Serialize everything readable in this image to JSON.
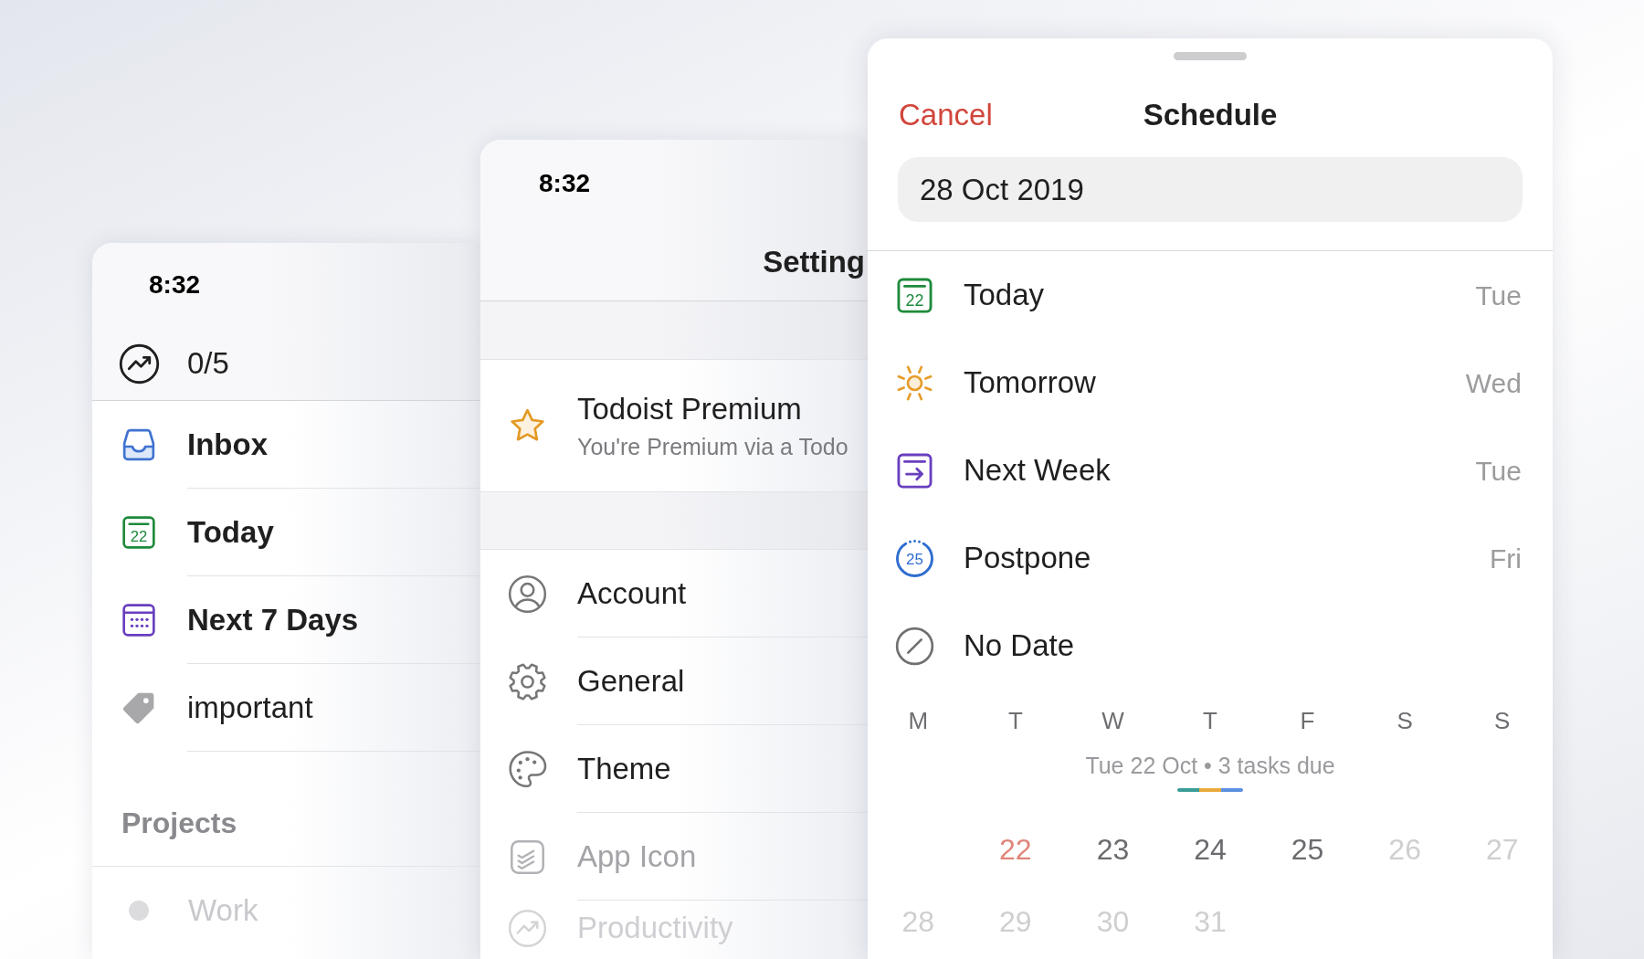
{
  "sidebar_screen": {
    "status_time": "8:32",
    "karma": "0/5",
    "items": [
      {
        "label": "Inbox",
        "kind": "inbox"
      },
      {
        "label": "Today",
        "kind": "today",
        "icon_label": "22"
      },
      {
        "label": "Next 7 Days",
        "kind": "upcoming"
      },
      {
        "label": "important",
        "kind": "label"
      }
    ],
    "projects_heading": "Projects",
    "projects": [
      {
        "name": "Work",
        "color": "#dcdcdf"
      }
    ]
  },
  "settings_screen": {
    "status_time": "8:32",
    "title": "Setting",
    "premium": {
      "title": "Todoist Premium",
      "subtitle": "You're Premium via a Todo"
    },
    "items": [
      {
        "label": "Account",
        "kind": "account"
      },
      {
        "label": "General",
        "kind": "general"
      },
      {
        "label": "Theme",
        "kind": "theme"
      },
      {
        "label": "App Icon",
        "kind": "app_icon"
      },
      {
        "label": "Productivity",
        "kind": "productivity"
      }
    ]
  },
  "schedule_sheet": {
    "cancel": "Cancel",
    "title": "Schedule",
    "date_field": {
      "value": "28 Oct 2019"
    },
    "options": [
      {
        "label": "Today",
        "day": "Tue",
        "kind": "today",
        "icon_label": "22"
      },
      {
        "label": "Tomorrow",
        "day": "Wed",
        "kind": "tomorrow"
      },
      {
        "label": "Next Week",
        "day": "Tue",
        "kind": "next_week"
      },
      {
        "label": "Postpone",
        "day": "Fri",
        "kind": "postpone",
        "icon_label": "25"
      },
      {
        "label": "No Date",
        "kind": "no_date"
      }
    ],
    "calendar": {
      "weekdays": [
        "M",
        "T",
        "W",
        "T",
        "F",
        "S",
        "S"
      ],
      "summary": "Tue 22 Oct • 3 tasks due",
      "due_markers": [
        {
          "color": "#3a9d97"
        },
        {
          "color": "#e9aa3c"
        },
        {
          "color": "#5c8fe2"
        }
      ],
      "weeks": [
        [
          {
            "label": "22",
            "today": true,
            "dimmed": false
          },
          {
            "label": "23",
            "today": false,
            "dimmed": false
          },
          {
            "label": "24",
            "today": false,
            "dimmed": false
          },
          {
            "label": "25",
            "today": false,
            "dimmed": false
          },
          {
            "label": "26",
            "today": false,
            "dimmed": true
          },
          {
            "label": "27",
            "today": false,
            "dimmed": true
          }
        ],
        [
          {
            "label": "28",
            "today": false,
            "dimmed": true
          },
          {
            "label": "29",
            "today": false,
            "dimmed": true
          },
          {
            "label": "30",
            "today": false,
            "dimmed": true
          },
          {
            "label": "31",
            "today": false,
            "dimmed": true
          }
        ]
      ]
    }
  }
}
